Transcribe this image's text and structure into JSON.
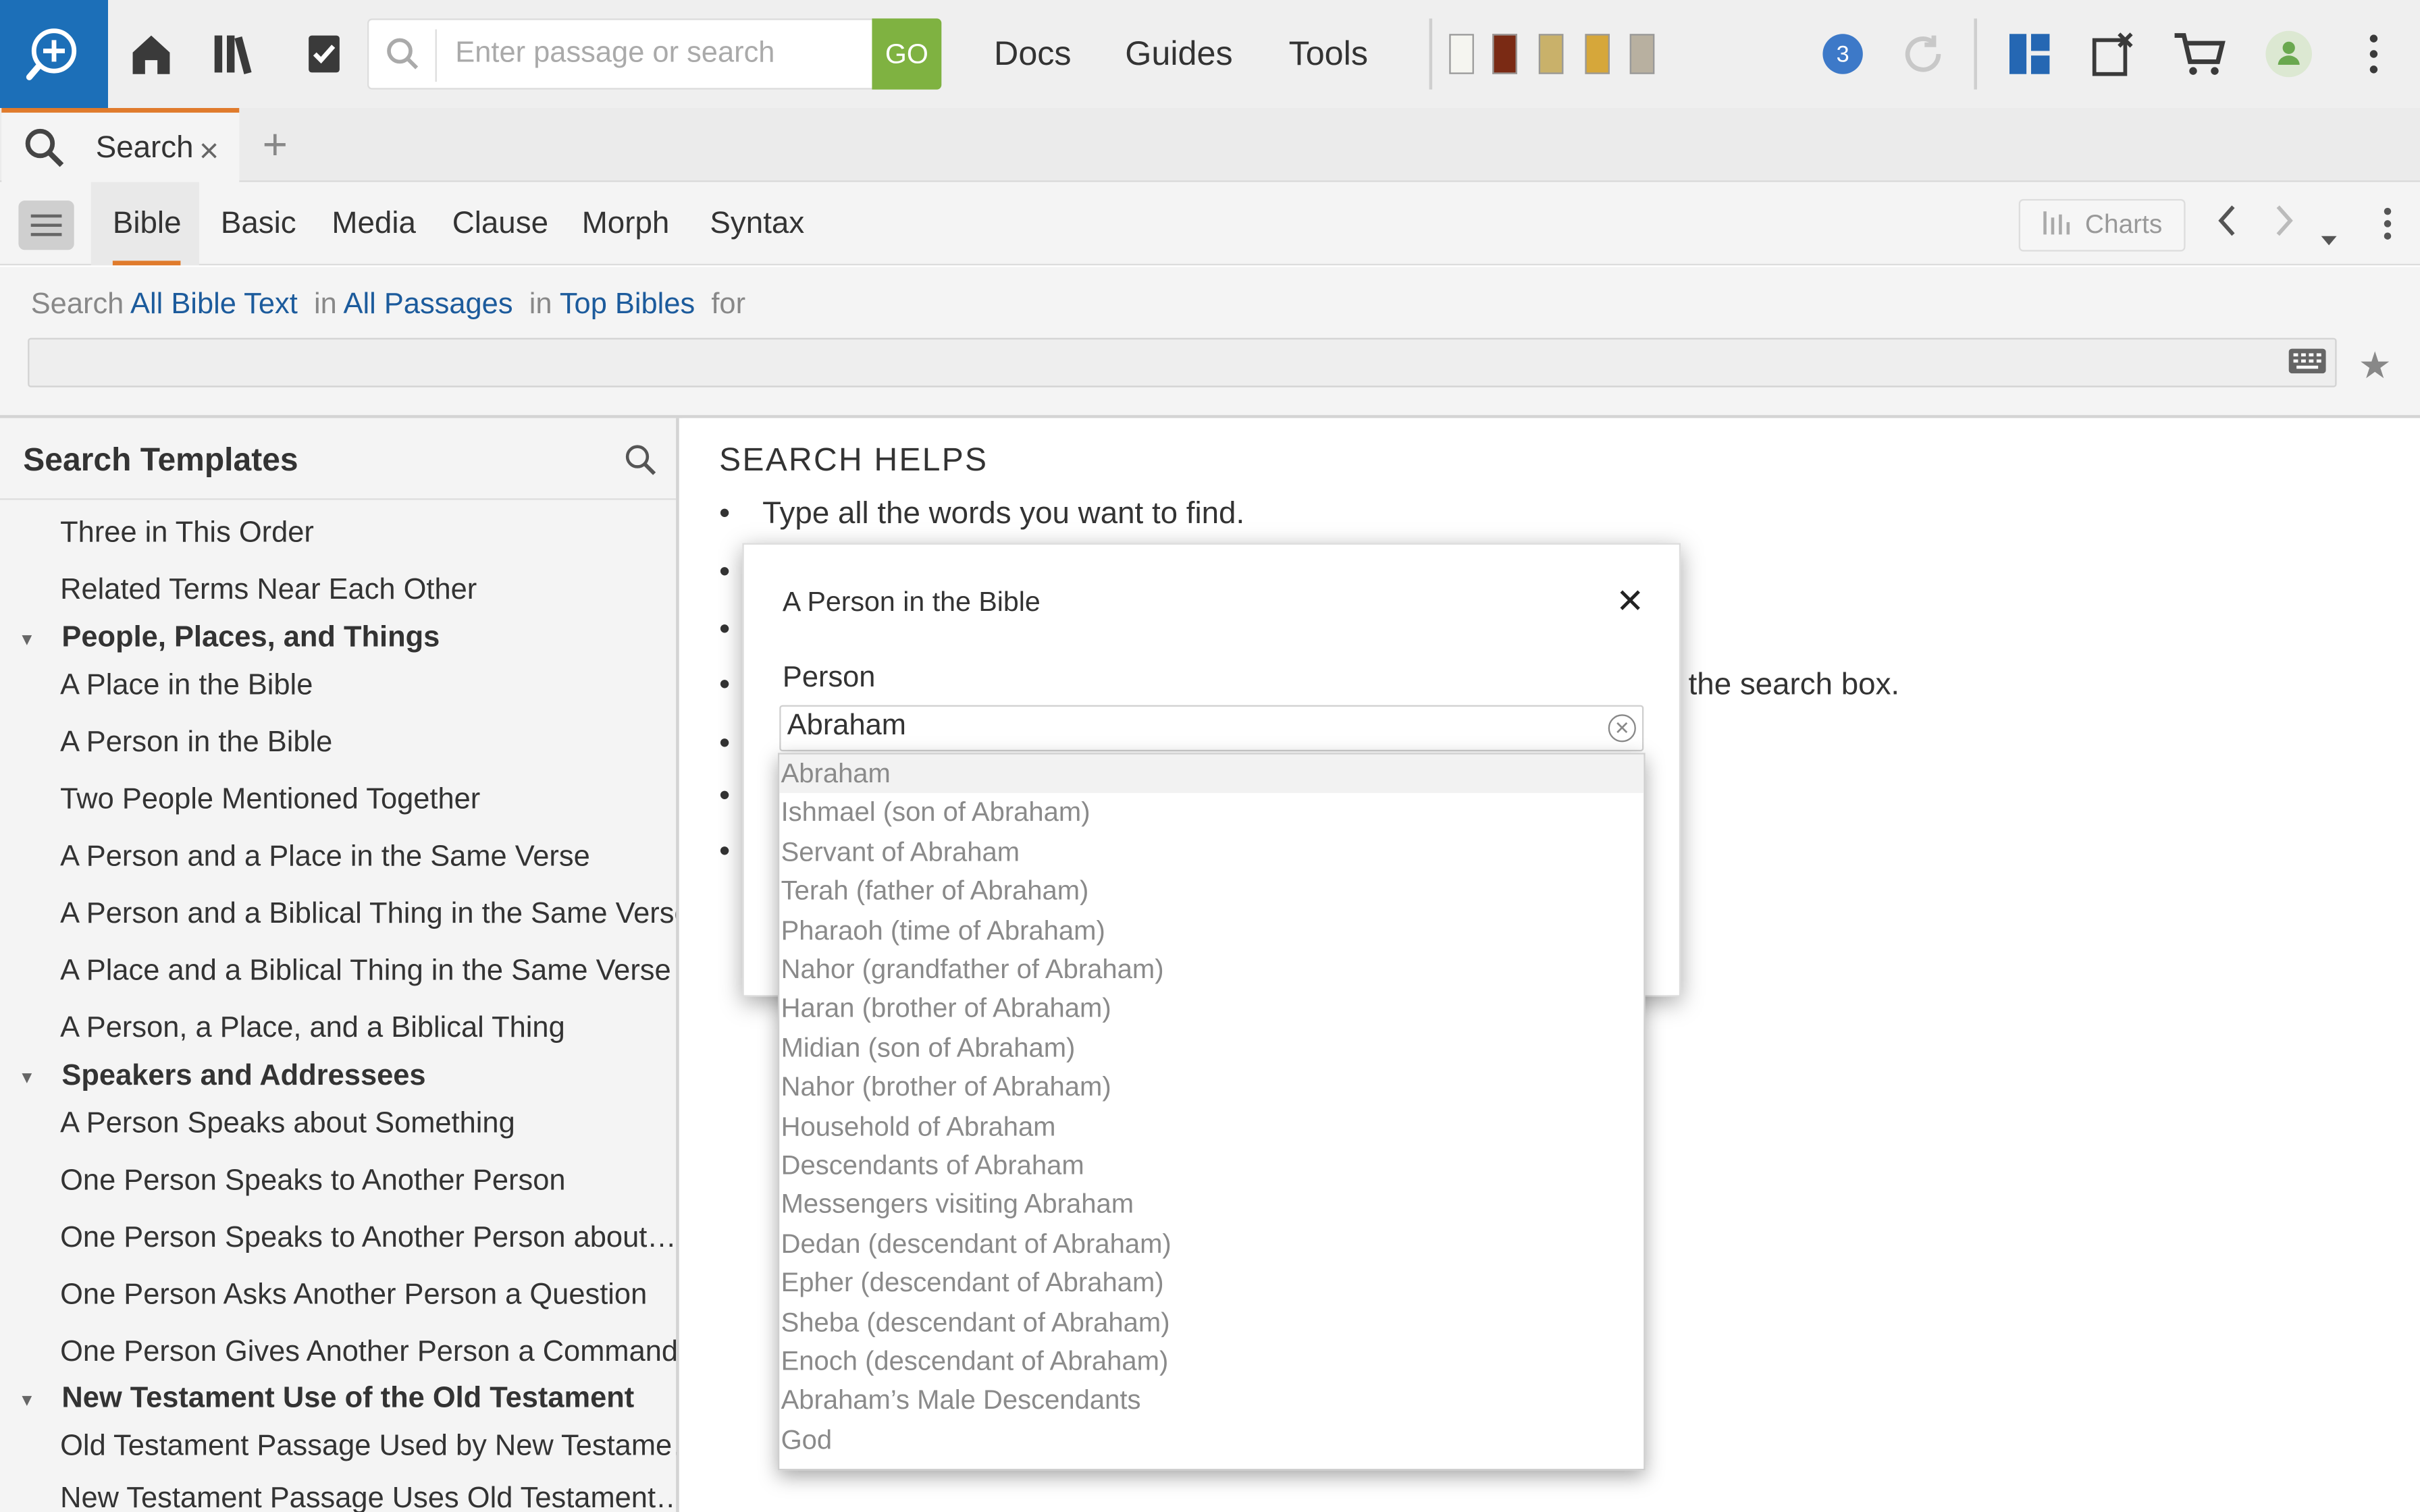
{
  "toolbar": {
    "search_placeholder": "Enter passage or search",
    "go_label": "GO",
    "nav": [
      "Docs",
      "Guides",
      "Tools"
    ],
    "notification_count": "3",
    "accent_color": "#1c6fb8",
    "go_color": "#7fb241"
  },
  "tabs": {
    "active_label": "Search",
    "close_glyph": "×",
    "add_glyph": "+"
  },
  "subnav": {
    "tabs": [
      "Bible",
      "Basic",
      "Media",
      "Clause",
      "Morph",
      "Syntax"
    ],
    "charts_label": "Charts"
  },
  "search_row": {
    "prefix": "Search",
    "scope": "All Bible Text",
    "in1": "in",
    "passages": "All Passages",
    "in2": "in",
    "collection": "Top Bibles",
    "for": "for"
  },
  "templates": {
    "title": "Search Templates",
    "items": [
      {
        "kind": "item",
        "label": "Three in This Order"
      },
      {
        "kind": "item",
        "label": "Related Terms Near Each Other"
      },
      {
        "kind": "group",
        "label": "People, Places, and Things"
      },
      {
        "kind": "item",
        "label": "A Place in the Bible"
      },
      {
        "kind": "item",
        "label": "A Person in the Bible"
      },
      {
        "kind": "item",
        "label": "Two People Mentioned Together"
      },
      {
        "kind": "item",
        "label": "A Person and a Place in the Same Verse"
      },
      {
        "kind": "item",
        "label": "A Person and a Biblical Thing in the Same Verse"
      },
      {
        "kind": "item",
        "label": "A Place and a Biblical Thing in the Same Verse"
      },
      {
        "kind": "item",
        "label": "A Person, a Place, and a Biblical Thing"
      },
      {
        "kind": "group",
        "label": "Speakers and Addressees"
      },
      {
        "kind": "item",
        "label": "A Person Speaks about Something"
      },
      {
        "kind": "item",
        "label": "One Person Speaks to Another Person"
      },
      {
        "kind": "item",
        "label": "One Person Speaks to Another Person about…"
      },
      {
        "kind": "item",
        "label": "One Person Asks Another Person a Question"
      },
      {
        "kind": "item",
        "label": "One Person Gives Another Person a Command"
      },
      {
        "kind": "group",
        "label": "New Testament Use of the Old Testament"
      },
      {
        "kind": "item",
        "label": "Old Testament Passage Used by New Testame…"
      },
      {
        "kind": "item",
        "label": "New Testament Passage Uses Old Testament…"
      }
    ]
  },
  "helps": {
    "title": "SEARCH HELPS",
    "first": "Type all the words you want to find.",
    "partial_tail": "the search box."
  },
  "modal": {
    "title": "A Person in the Bible",
    "close_glyph": "✕",
    "field_label": "Person",
    "field_value": "Abraham"
  },
  "dropdown": {
    "selected_index": 0,
    "options": [
      "Abraham",
      "Ishmael (son of Abraham)",
      "Servant of Abraham",
      "Terah (father of Abraham)",
      "Pharaoh (time of Abraham)",
      "Nahor (grandfather of Abraham)",
      "Haran (brother of Abraham)",
      "Midian (son of Abraham)",
      "Nahor (brother of Abraham)",
      "Household of Abraham",
      "Descendants of Abraham",
      "Messengers visiting Abraham",
      "Dedan (descendant of Abraham)",
      "Epher (descendant of Abraham)",
      "Sheba (descendant of Abraham)",
      "Enoch (descendant of Abraham)",
      "Abraham’s Male Descendants",
      "God"
    ]
  }
}
